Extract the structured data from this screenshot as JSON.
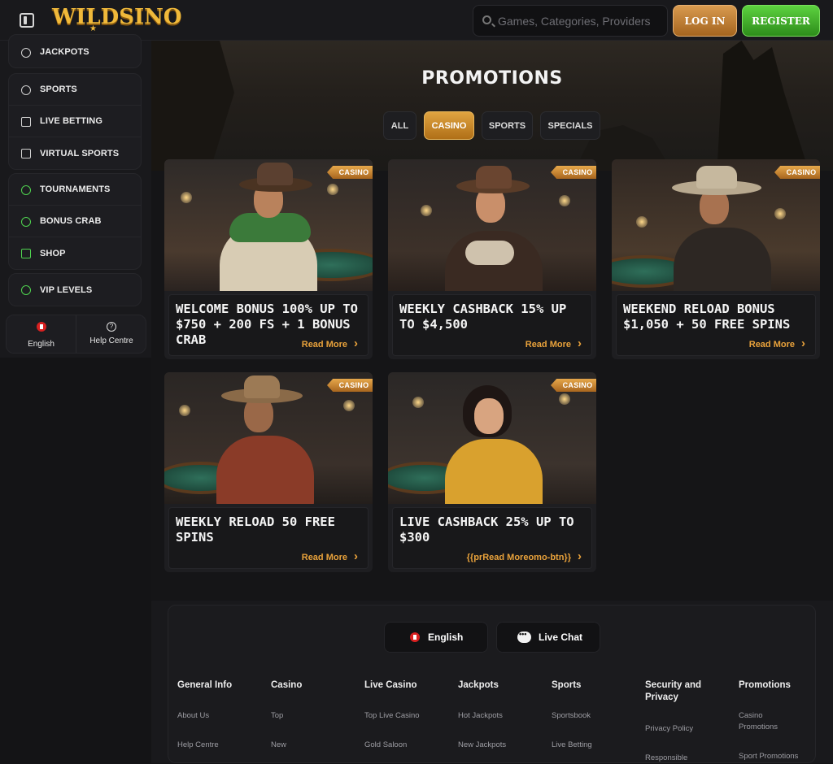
{
  "header": {
    "logo_text": "WILDSINO",
    "logo_star": "★",
    "search_placeholder": "Games, Categories, Providers",
    "login_label": "LOG IN",
    "register_label": "REGISTER"
  },
  "sidebar": {
    "groups": [
      {
        "items": [
          {
            "label": "JACKPOTS",
            "icon": "jackpot-icon"
          }
        ]
      },
      {
        "items": [
          {
            "label": "SPORTS",
            "icon": "soccer-ball-icon"
          },
          {
            "label": "LIVE BETTING",
            "icon": "live-play-icon"
          },
          {
            "label": "VIRTUAL SPORTS",
            "icon": "gamepad-icon"
          }
        ]
      },
      {
        "items": [
          {
            "label": "TOURNAMENTS",
            "icon": "trophy-icon"
          },
          {
            "label": "BONUS CRAB",
            "icon": "crab-icon"
          },
          {
            "label": "SHOP",
            "icon": "shop-icon"
          }
        ]
      },
      {
        "items": [
          {
            "label": "VIP LEVELS",
            "icon": "diamond-icon"
          }
        ]
      }
    ],
    "language_label": "English",
    "help_label": "Help Centre",
    "help_icon_glyph": "?"
  },
  "page": {
    "title": "PROMOTIONS",
    "filters": [
      {
        "label": "ALL",
        "active": false
      },
      {
        "label": "CASINO",
        "active": true
      },
      {
        "label": "SPORTS",
        "active": false
      },
      {
        "label": "SPECIALS",
        "active": false
      }
    ]
  },
  "promotions": [
    {
      "badge": "CASINO",
      "title": "WELCOME BONUS 100% UP TO $750 + 200 FS + 1 BONUS CRAB",
      "link": "Read More"
    },
    {
      "badge": "CASINO",
      "title": "WEEKLY CASHBACK 15% UP TO $4,500",
      "link": "Read More"
    },
    {
      "badge": "CASINO",
      "title": "WEEKEND RELOAD BONUS $1,050 + 50 FREE SPINS",
      "link": "Read More"
    },
    {
      "badge": "CASINO",
      "title": "WEEKLY RELOAD 50 FREE SPINS",
      "link": "Read More"
    },
    {
      "badge": "CASINO",
      "title": "LIVE CASHBACK 25% UP TO $300",
      "link": "{{prRead Moreomo-btn}}"
    }
  ],
  "footer": {
    "language_label": "English",
    "chat_label": "Live Chat",
    "columns": [
      {
        "heading": "General Info",
        "links": [
          "About Us",
          "Help Centre"
        ]
      },
      {
        "heading": "Casino",
        "links": [
          "Top",
          "New"
        ]
      },
      {
        "heading": "Live Casino",
        "links": [
          "Top Live Casino",
          "Gold Saloon"
        ]
      },
      {
        "heading": "Jackpots",
        "links": [
          "Hot Jackpots",
          "New Jackpots"
        ]
      },
      {
        "heading": "Sports",
        "links": [
          "Sportsbook",
          "Live Betting"
        ]
      },
      {
        "heading": "Security and Privacy",
        "links": [
          "Privacy Policy",
          "Responsible"
        ]
      },
      {
        "heading": "Promotions",
        "links": [
          "Casino Promotions",
          "Sport Promotions"
        ]
      }
    ]
  },
  "colors": {
    "accent_gold": "#e9a23b",
    "register_green": "#4cbf34",
    "background": "#141416"
  }
}
